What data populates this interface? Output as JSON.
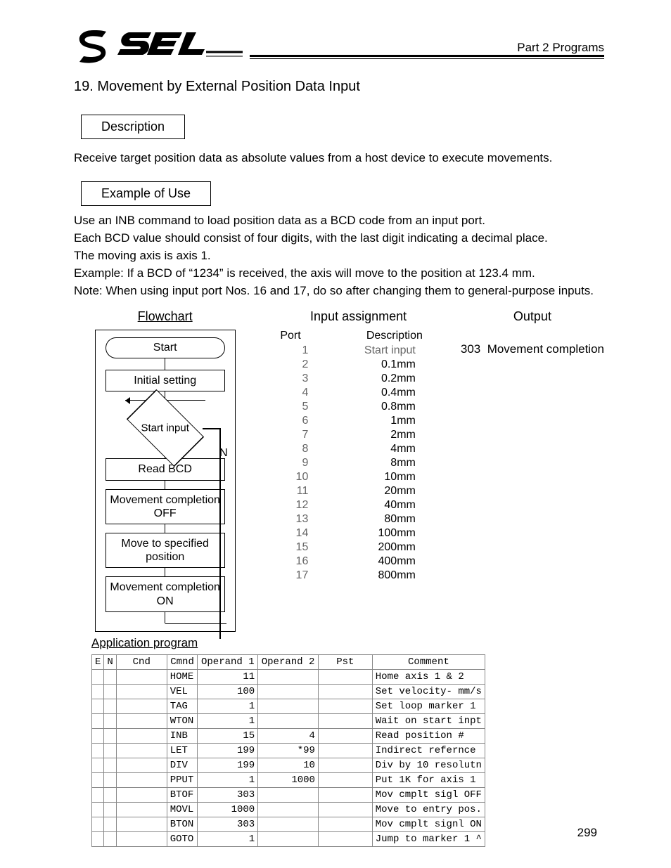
{
  "header": {
    "part_label": "Part 2 Programs",
    "logo_text": "SEL"
  },
  "section": {
    "number": "19.",
    "title": "Movement by External Position Data Input"
  },
  "description": {
    "label": "Description",
    "text": "Receive target position data as absolute values from a host device to execute movements."
  },
  "example": {
    "label": "Example of Use",
    "lines": [
      "Use an INB command to load position data as a BCD code from an input port.",
      "Each BCD value should consist of four digits, with the last digit indicating a decimal place.",
      "The moving axis is axis 1.",
      "Example: If a BCD of “1234” is received, the axis will move to the position at 123.4 mm.",
      "Note: When using input port Nos. 16 and 17, do so after changing them to general-purpose inputs."
    ]
  },
  "flowchart": {
    "heading": "Flowchart",
    "start": "Start",
    "steps": [
      "Initial setting",
      "Start input",
      "Read BCD",
      "Movement completion OFF",
      "Move to specified position",
      "Movement completion ON"
    ],
    "branch_label": "N"
  },
  "input_assignment": {
    "heading": "Input assignment",
    "col_port": "Port",
    "col_desc": "Description",
    "rows": [
      {
        "port": "1",
        "desc": "Start input"
      },
      {
        "port": "2",
        "desc": "0.1mm"
      },
      {
        "port": "3",
        "desc": "0.2mm"
      },
      {
        "port": "4",
        "desc": "0.4mm"
      },
      {
        "port": "5",
        "desc": "0.8mm"
      },
      {
        "port": "6",
        "desc": "1mm"
      },
      {
        "port": "7",
        "desc": "2mm"
      },
      {
        "port": "8",
        "desc": "4mm"
      },
      {
        "port": "9",
        "desc": "8mm"
      },
      {
        "port": "10",
        "desc": "10mm"
      },
      {
        "port": "11",
        "desc": "20mm"
      },
      {
        "port": "12",
        "desc": "40mm"
      },
      {
        "port": "13",
        "desc": "80mm"
      },
      {
        "port": "14",
        "desc": "100mm"
      },
      {
        "port": "15",
        "desc": "200mm"
      },
      {
        "port": "16",
        "desc": "400mm"
      },
      {
        "port": "17",
        "desc": "800mm"
      }
    ]
  },
  "output": {
    "heading": "Output",
    "port": "303",
    "desc": "Movement completion"
  },
  "program": {
    "heading": "Application program",
    "columns": [
      "E",
      "N",
      "Cnd",
      "Cmnd",
      "Operand 1",
      "Operand 2",
      "Pst",
      "Comment"
    ],
    "rows": [
      {
        "e": "",
        "n": "",
        "cnd": "",
        "cmd": "HOME",
        "o1": "11",
        "o2": "",
        "pst": "",
        "com": "Home axis 1 & 2"
      },
      {
        "e": "",
        "n": "",
        "cnd": "",
        "cmd": "VEL",
        "o1": "100",
        "o2": "",
        "pst": "",
        "com": "Set velocity- mm/s"
      },
      {
        "e": "",
        "n": "",
        "cnd": "",
        "cmd": "TAG",
        "o1": "1",
        "o2": "",
        "pst": "",
        "com": "Set loop marker 1"
      },
      {
        "e": "",
        "n": "",
        "cnd": "",
        "cmd": "WTON",
        "o1": "1",
        "o2": "",
        "pst": "",
        "com": "Wait on start inpt"
      },
      {
        "e": "",
        "n": "",
        "cnd": "",
        "cmd": "INB",
        "o1": "15",
        "o2": "4",
        "pst": "",
        "com": "Read position #"
      },
      {
        "e": "",
        "n": "",
        "cnd": "",
        "cmd": "LET",
        "o1": "199",
        "o2": "*99",
        "pst": "",
        "com": "Indirect refernce"
      },
      {
        "e": "",
        "n": "",
        "cnd": "",
        "cmd": "DIV",
        "o1": "199",
        "o2": "10",
        "pst": "",
        "com": "Div by 10 resolutn"
      },
      {
        "e": "",
        "n": "",
        "cnd": "",
        "cmd": "PPUT",
        "o1": "1",
        "o2": "1000",
        "pst": "",
        "com": "Put 1K for axis 1"
      },
      {
        "e": "",
        "n": "",
        "cnd": "",
        "cmd": "BTOF",
        "o1": "303",
        "o2": "",
        "pst": "",
        "com": "Mov cmplt sigl OFF"
      },
      {
        "e": "",
        "n": "",
        "cnd": "",
        "cmd": "MOVL",
        "o1": "1000",
        "o2": "",
        "pst": "",
        "com": "Move to entry pos."
      },
      {
        "e": "",
        "n": "",
        "cnd": "",
        "cmd": "BTON",
        "o1": "303",
        "o2": "",
        "pst": "",
        "com": "Mov cmplt signl ON"
      },
      {
        "e": "",
        "n": "",
        "cnd": "",
        "cmd": "GOTO",
        "o1": "1",
        "o2": "",
        "pst": "",
        "com": "Jump to marker 1 ^"
      }
    ]
  },
  "page_number": "299"
}
